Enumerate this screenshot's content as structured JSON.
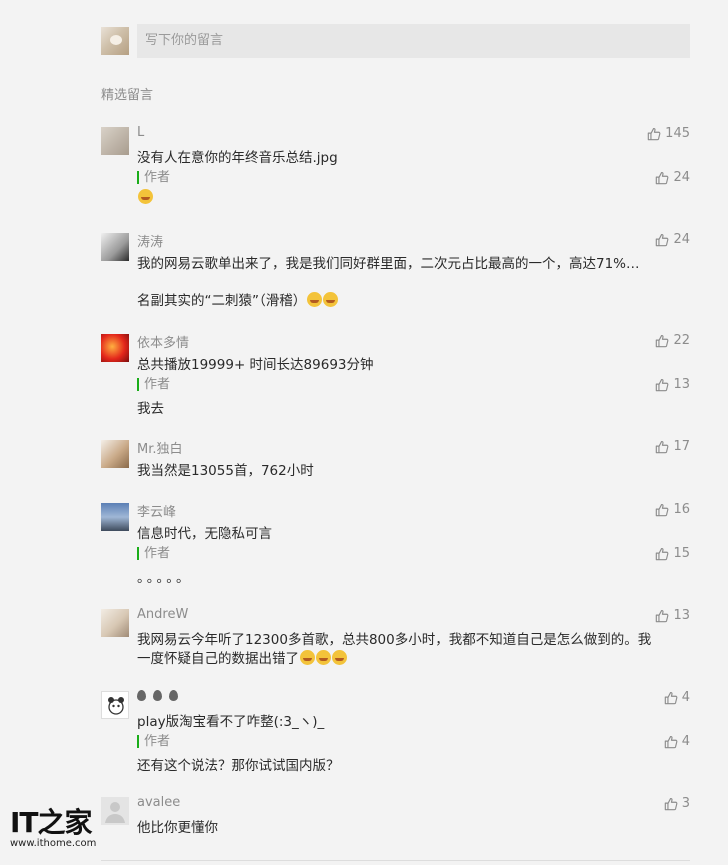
{
  "compose": {
    "placeholder": "写下你的留言"
  },
  "section_title": "精选留言",
  "comments": [
    {
      "nick": "L",
      "lines": [
        "没有人在意你的年终音乐总结.jpg"
      ],
      "likes": "145",
      "reply": {
        "label": "作者",
        "text": "",
        "likes": "24"
      }
    },
    {
      "nick": "涛涛",
      "lines": [
        "我的网易云歌单出来了，我是我们同好群里面，二次元占比最高的一个，高达71%…",
        "名副其实的“二刺猿”（滑稽）"
      ],
      "likes": "24"
    },
    {
      "nick": "依本多情",
      "lines": [
        "总共播放19999+     时间长达89693分钟"
      ],
      "likes": "22",
      "reply": {
        "label": "作者",
        "text": "我去",
        "likes": "13"
      }
    },
    {
      "nick": "Mr.独白",
      "lines": [
        "我当然是13055首，762小时"
      ],
      "likes": "17"
    },
    {
      "nick": "李云峰",
      "lines": [
        "信息时代，无隐私可言"
      ],
      "likes": "16",
      "reply": {
        "label": "作者",
        "text": "。。。。。",
        "likes": "15"
      }
    },
    {
      "nick": "AndreW",
      "lines": [
        "我网易云今年听了12300多首歌，总共800多小时，我都不知道自己是怎么做到的。我",
        "一度怀疑自己的数据出错了"
      ],
      "likes": "13"
    },
    {
      "nick": "",
      "lines": [
        "play版淘宝看不了咋整(:3_ヽ)_"
      ],
      "likes": "4",
      "reply": {
        "label": "作者",
        "text": "还有这个说法？那你试试国内版？",
        "likes": "4"
      }
    },
    {
      "nick": "avalee",
      "lines": [
        "他比你更懂你"
      ],
      "likes": "3"
    }
  ],
  "watermark": {
    "logo": "IT之家",
    "url": "www.ithome.com"
  }
}
